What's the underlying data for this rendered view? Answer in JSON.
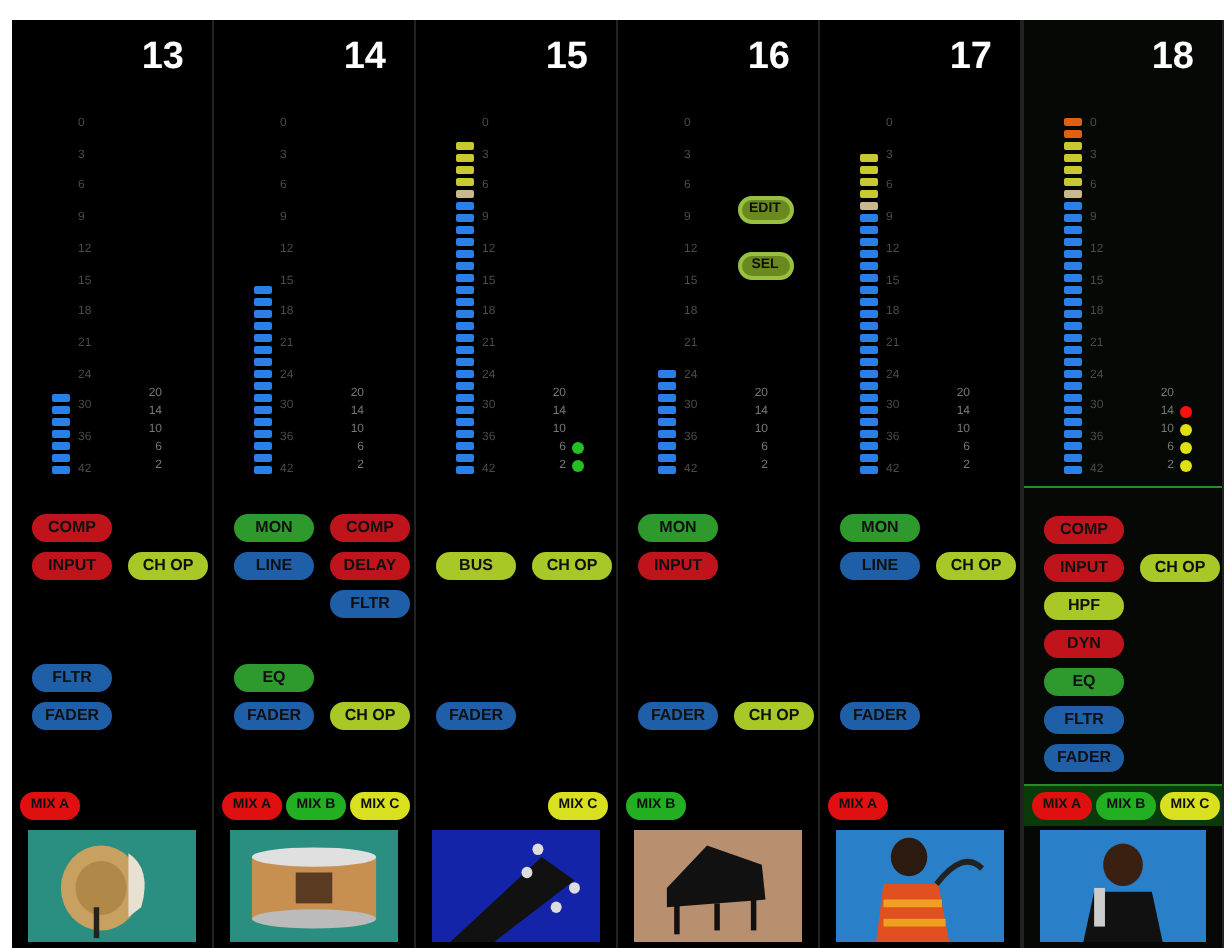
{
  "channels": [
    {
      "number": "13",
      "selected": false,
      "leds": [
        {
          "color": "#2a80e8"
        },
        {
          "color": "#2a80e8"
        },
        {
          "color": "#2a80e8"
        },
        {
          "color": "#2a80e8"
        },
        {
          "color": "#2a80e8"
        },
        {
          "color": "#2a80e8"
        },
        {
          "color": "#2a80e8"
        }
      ],
      "scale": [
        "0",
        "3",
        "6",
        "9",
        "12",
        "15",
        "18",
        "21",
        "24",
        "30",
        "36",
        "42"
      ],
      "gr": [
        {
          "label": "20"
        },
        {
          "label": "14"
        },
        {
          "label": "10"
        },
        {
          "label": "6"
        },
        {
          "label": "2"
        }
      ],
      "upper": [
        {
          "left": {
            "label": "COMP",
            "color": "#c0141c"
          }
        },
        {
          "left": {
            "label": "INPUT",
            "color": "#c0141c"
          },
          "right": {
            "label": "CH OP",
            "color": "#a8c828"
          }
        }
      ],
      "lower": [
        {
          "left": {
            "label": "FLTR",
            "color": "#1f5fa8"
          }
        },
        {
          "left": {
            "label": "FADER",
            "color": "#1f5fa8"
          }
        }
      ],
      "mix": [
        {
          "label": "MIX A",
          "color": "#e01010"
        }
      ]
    },
    {
      "number": "14",
      "selected": false,
      "leds": [
        {
          "color": "#2a80e8"
        },
        {
          "color": "#2a80e8"
        },
        {
          "color": "#2a80e8"
        },
        {
          "color": "#2a80e8"
        },
        {
          "color": "#2a80e8"
        },
        {
          "color": "#2a80e8"
        },
        {
          "color": "#2a80e8"
        },
        {
          "color": "#2a80e8"
        },
        {
          "color": "#2a80e8"
        },
        {
          "color": "#2a80e8"
        },
        {
          "color": "#2a80e8"
        },
        {
          "color": "#2a80e8"
        },
        {
          "color": "#2a80e8"
        },
        {
          "color": "#2a80e8"
        },
        {
          "color": "#2a80e8"
        },
        {
          "color": "#2a80e8"
        }
      ],
      "scale": [
        "0",
        "3",
        "6",
        "9",
        "12",
        "15",
        "18",
        "21",
        "24",
        "30",
        "36",
        "42"
      ],
      "gr": [
        {
          "label": "20"
        },
        {
          "label": "14"
        },
        {
          "label": "10"
        },
        {
          "label": "6"
        },
        {
          "label": "2"
        }
      ],
      "upper": [
        {
          "left": {
            "label": "MON",
            "color": "#2e9a2e"
          },
          "right": {
            "label": "COMP",
            "color": "#c0141c"
          }
        },
        {
          "left": {
            "label": "LINE",
            "color": "#1f5fa8"
          },
          "right": {
            "label": "DELAY",
            "color": "#c0141c"
          }
        },
        {
          "right": {
            "label": "FLTR",
            "color": "#1f5fa8"
          }
        }
      ],
      "lower": [
        {
          "left": {
            "label": "EQ",
            "color": "#2e9a2e"
          }
        },
        {
          "left": {
            "label": "FADER",
            "color": "#1f5fa8"
          },
          "right": {
            "label": "CH OP",
            "color": "#a8c828"
          }
        }
      ],
      "mix": [
        {
          "label": "MIX A",
          "color": "#e01010"
        },
        {
          "label": "MIX B",
          "color": "#22b022"
        },
        {
          "label": "MIX C",
          "color": "#d8e020"
        }
      ]
    },
    {
      "number": "15",
      "selected": false,
      "leds": [
        {
          "color": "#c8c830"
        },
        {
          "color": "#c8c830"
        },
        {
          "color": "#c8c830"
        },
        {
          "color": "#c8c830"
        },
        {
          "color": "#c8b890"
        },
        {
          "color": "#2a80e8"
        },
        {
          "color": "#2a80e8"
        },
        {
          "color": "#2a80e8"
        },
        {
          "color": "#2a80e8"
        },
        {
          "color": "#2a80e8"
        },
        {
          "color": "#2a80e8"
        },
        {
          "color": "#2a80e8"
        },
        {
          "color": "#2a80e8"
        },
        {
          "color": "#2a80e8"
        },
        {
          "color": "#2a80e8"
        },
        {
          "color": "#2a80e8"
        },
        {
          "color": "#2a80e8"
        },
        {
          "color": "#2a80e8"
        },
        {
          "color": "#2a80e8"
        },
        {
          "color": "#2a80e8"
        },
        {
          "color": "#2a80e8"
        },
        {
          "color": "#2a80e8"
        },
        {
          "color": "#2a80e8"
        },
        {
          "color": "#2a80e8"
        },
        {
          "color": "#2a80e8"
        },
        {
          "color": "#2a80e8"
        },
        {
          "color": "#2a80e8"
        },
        {
          "color": "#2a80e8"
        }
      ],
      "scale": [
        "0",
        "3",
        "6",
        "9",
        "12",
        "15",
        "18",
        "21",
        "24",
        "30",
        "36",
        "42"
      ],
      "gr": [
        {
          "label": "20"
        },
        {
          "label": "14"
        },
        {
          "label": "10"
        },
        {
          "label": "6",
          "color": "#22c022"
        },
        {
          "label": "2",
          "color": "#22c022"
        }
      ],
      "upper": [
        {
          "left": {
            "label": "BUS",
            "color": "#a8c828"
          },
          "right": {
            "label": "CH OP",
            "color": "#a8c828"
          }
        }
      ],
      "lower": [
        {
          "left": {
            "label": "FADER",
            "color": "#1f5fa8"
          }
        }
      ],
      "mix": [
        {
          "label": "MIX C",
          "color": "#d8e020"
        }
      ]
    },
    {
      "number": "16",
      "selected": false,
      "leds": [
        {
          "color": "#2a80e8"
        },
        {
          "color": "#2a80e8"
        },
        {
          "color": "#2a80e8"
        },
        {
          "color": "#2a80e8"
        },
        {
          "color": "#2a80e8"
        },
        {
          "color": "#2a80e8"
        },
        {
          "color": "#2a80e8"
        },
        {
          "color": "#2a80e8"
        },
        {
          "color": "#2a80e8"
        }
      ],
      "scale": [
        "0",
        "3",
        "6",
        "9",
        "12",
        "15",
        "18",
        "21",
        "24",
        "30",
        "36",
        "42"
      ],
      "buttons": [
        "EDIT",
        "SEL"
      ],
      "gr": [
        {
          "label": "20"
        },
        {
          "label": "14"
        },
        {
          "label": "10"
        },
        {
          "label": "6"
        },
        {
          "label": "2"
        }
      ],
      "upper": [
        {
          "left": {
            "label": "MON",
            "color": "#2e9a2e"
          }
        },
        {
          "left": {
            "label": "INPUT",
            "color": "#c0141c"
          }
        }
      ],
      "lower": [
        {
          "left": {
            "label": "FADER",
            "color": "#1f5fa8"
          },
          "right": {
            "label": "CH OP",
            "color": "#a8c828"
          }
        }
      ],
      "mix": [
        {
          "label": "MIX B",
          "color": "#22b022"
        }
      ]
    },
    {
      "number": "17",
      "selected": false,
      "leds": [
        {
          "color": "#c8c830"
        },
        {
          "color": "#c8c830"
        },
        {
          "color": "#c8c830"
        },
        {
          "color": "#c8c830"
        },
        {
          "color": "#c8b890"
        },
        {
          "color": "#2a80e8"
        },
        {
          "color": "#2a80e8"
        },
        {
          "color": "#2a80e8"
        },
        {
          "color": "#2a80e8"
        },
        {
          "color": "#2a80e8"
        },
        {
          "color": "#2a80e8"
        },
        {
          "color": "#2a80e8"
        },
        {
          "color": "#2a80e8"
        },
        {
          "color": "#2a80e8"
        },
        {
          "color": "#2a80e8"
        },
        {
          "color": "#2a80e8"
        },
        {
          "color": "#2a80e8"
        },
        {
          "color": "#2a80e8"
        },
        {
          "color": "#2a80e8"
        },
        {
          "color": "#2a80e8"
        },
        {
          "color": "#2a80e8"
        },
        {
          "color": "#2a80e8"
        },
        {
          "color": "#2a80e8"
        },
        {
          "color": "#2a80e8"
        },
        {
          "color": "#2a80e8"
        },
        {
          "color": "#2a80e8"
        },
        {
          "color": "#2a80e8"
        }
      ],
      "scale": [
        "0",
        "3",
        "6",
        "9",
        "12",
        "15",
        "18",
        "21",
        "24",
        "30",
        "36",
        "42"
      ],
      "gr": [
        {
          "label": "20"
        },
        {
          "label": "14"
        },
        {
          "label": "10"
        },
        {
          "label": "6"
        },
        {
          "label": "2"
        }
      ],
      "upper": [
        {
          "left": {
            "label": "MON",
            "color": "#2e9a2e"
          }
        },
        {
          "left": {
            "label": "LINE",
            "color": "#1f5fa8"
          },
          "right": {
            "label": "CH OP",
            "color": "#a8c828"
          }
        }
      ],
      "lower": [
        {
          "left": {
            "label": "FADER",
            "color": "#1f5fa8"
          }
        }
      ],
      "mix": [
        {
          "label": "MIX A",
          "color": "#e01010"
        }
      ]
    },
    {
      "number": "18",
      "selected": true,
      "leds": [
        {
          "color": "#e06010"
        },
        {
          "color": "#e06010"
        },
        {
          "color": "#c8c830"
        },
        {
          "color": "#c8c830"
        },
        {
          "color": "#c8c830"
        },
        {
          "color": "#c8c830"
        },
        {
          "color": "#c8b890"
        },
        {
          "color": "#2a80e8"
        },
        {
          "color": "#2a80e8"
        },
        {
          "color": "#2a80e8"
        },
        {
          "color": "#2a80e8"
        },
        {
          "color": "#2a80e8"
        },
        {
          "color": "#2a80e8"
        },
        {
          "color": "#2a80e8"
        },
        {
          "color": "#2a80e8"
        },
        {
          "color": "#2a80e8"
        },
        {
          "color": "#2a80e8"
        },
        {
          "color": "#2a80e8"
        },
        {
          "color": "#2a80e8"
        },
        {
          "color": "#2a80e8"
        },
        {
          "color": "#2a80e8"
        },
        {
          "color": "#2a80e8"
        },
        {
          "color": "#2a80e8"
        },
        {
          "color": "#2a80e8"
        },
        {
          "color": "#2a80e8"
        },
        {
          "color": "#2a80e8"
        },
        {
          "color": "#2a80e8"
        },
        {
          "color": "#2a80e8"
        },
        {
          "color": "#2a80e8"
        },
        {
          "color": "#2a80e8"
        }
      ],
      "scale": [
        "0",
        "3",
        "6",
        "9",
        "12",
        "15",
        "18",
        "21",
        "24",
        "30",
        "36",
        "42"
      ],
      "gr": [
        {
          "label": "20"
        },
        {
          "label": "14",
          "color": "#ff1010"
        },
        {
          "label": "10",
          "color": "#e0e010"
        },
        {
          "label": "6",
          "color": "#e0e010"
        },
        {
          "label": "2",
          "color": "#e0e010"
        }
      ],
      "upper": [
        {
          "left": {
            "label": "COMP",
            "color": "#c0141c"
          }
        },
        {
          "left": {
            "label": "INPUT",
            "color": "#c0141c"
          },
          "right": {
            "label": "CH OP",
            "color": "#a8c828"
          }
        },
        {
          "left": {
            "label": "HPF",
            "color": "#a8c828"
          }
        },
        {
          "left": {
            "label": "DYN",
            "color": "#c0141c"
          }
        },
        {
          "left": {
            "label": "EQ",
            "color": "#2e9a2e"
          }
        },
        {
          "left": {
            "label": "FLTR",
            "color": "#1f5fa8"
          }
        },
        {
          "left": {
            "label": "FADER",
            "color": "#1f5fa8"
          }
        }
      ],
      "mix": [
        {
          "label": "MIX A",
          "color": "#e01010"
        },
        {
          "label": "MIX B",
          "color": "#22b022"
        },
        {
          "label": "MIX C",
          "color": "#d8e020"
        }
      ]
    }
  ]
}
